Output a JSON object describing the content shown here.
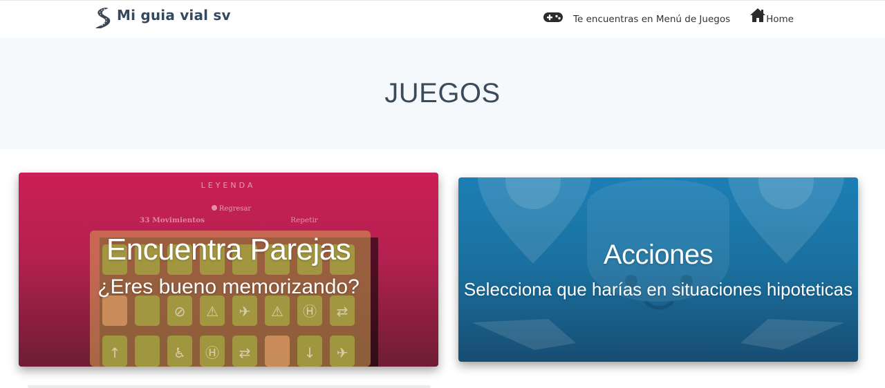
{
  "header": {
    "brand": "Mi guia vial sv",
    "brand_icon": "road-icon",
    "nav": [
      {
        "label": "Te encuentras en Menú de Juegos",
        "icon": "gamepad-icon"
      },
      {
        "label": "Home",
        "icon": "home-icon"
      }
    ]
  },
  "hero": {
    "title": "JUEGOS"
  },
  "cards": [
    {
      "title": "Encuentra Parejas",
      "subtitle": "¿Eres bueno memorizando?",
      "preview": {
        "heading": "LEYENDA",
        "back_label": "Regresar",
        "moves_label": "33 Movimientos",
        "repeat_label": "Repetir"
      },
      "color": "#cc1f56"
    },
    {
      "title": "Acciones",
      "subtitle": "Selecciona que harías en situaciones hipoteticas",
      "color": "#1d7fb5"
    }
  ],
  "colors": {
    "brand_text": "#34495e",
    "hero_bg": "#f5f9fc",
    "hero_title": "#3b4b5c"
  }
}
